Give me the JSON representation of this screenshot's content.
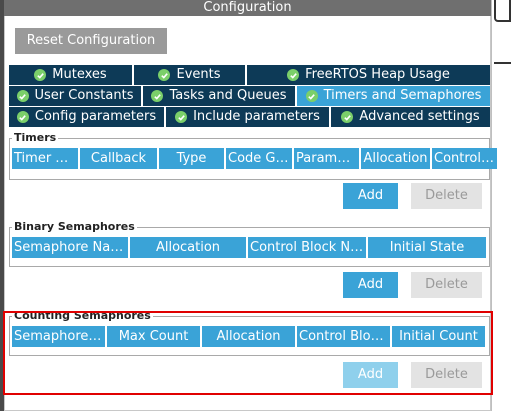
{
  "window": {
    "title": "Configuration"
  },
  "toolbar": {
    "reset_label": "Reset Configuration"
  },
  "tabs": {
    "row1": [
      {
        "label": "Mutexes"
      },
      {
        "label": "Events"
      },
      {
        "label": "FreeRTOS Heap Usage"
      }
    ],
    "row2": [
      {
        "label": "User Constants"
      },
      {
        "label": "Tasks and Queues"
      },
      {
        "label": "Timers and Semaphores",
        "active": true
      }
    ],
    "row3": [
      {
        "label": "Config parameters"
      },
      {
        "label": "Include parameters"
      },
      {
        "label": "Advanced settings"
      }
    ]
  },
  "timers": {
    "title": "Timers",
    "columns": [
      "Timer N...",
      "Callback",
      "Type",
      "Code Ge...",
      "Parameter",
      "Allocation",
      "Control ..."
    ],
    "add_label": "Add",
    "delete_label": "Delete"
  },
  "binary": {
    "title": "Binary Semaphores",
    "columns": [
      "Semaphore Name",
      "Allocation",
      "Control Block Na...",
      "Initial State"
    ],
    "add_label": "Add",
    "delete_label": "Delete"
  },
  "counting": {
    "title": "Counting Semaphores",
    "columns": [
      "Semaphore ...",
      "Max Count",
      "Allocation",
      "Control Bloc...",
      "Initial Count"
    ],
    "add_label": "Add",
    "delete_label": "Delete"
  },
  "colors": {
    "accent": "#3aa3d7",
    "tab_dark": "#0d3a57",
    "check": "#7bcf6a",
    "highlight": "#e00000"
  }
}
